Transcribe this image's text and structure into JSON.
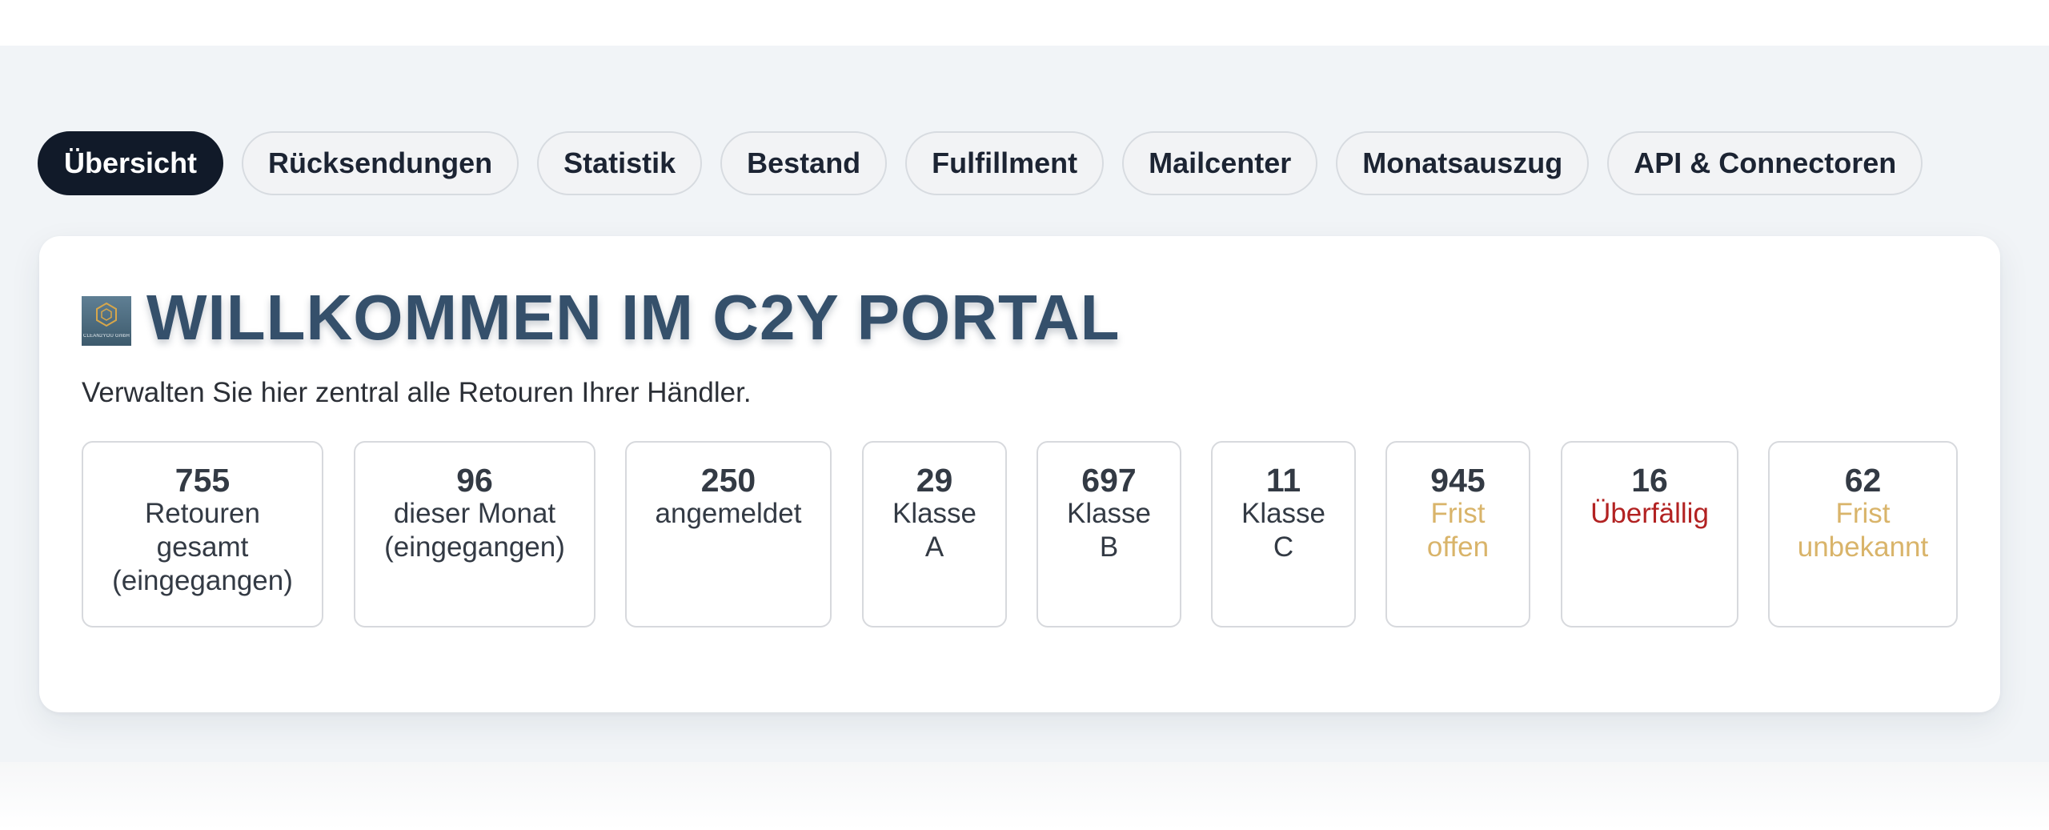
{
  "nav": {
    "tabs": [
      {
        "label": "Übersicht",
        "active": true
      },
      {
        "label": "Rücksendungen",
        "active": false
      },
      {
        "label": "Statistik",
        "active": false
      },
      {
        "label": "Bestand",
        "active": false
      },
      {
        "label": "Fulfillment",
        "active": false
      },
      {
        "label": "Mailcenter",
        "active": false
      },
      {
        "label": "Monatsauszug",
        "active": false
      },
      {
        "label": "API & Connectoren",
        "active": false
      }
    ]
  },
  "header": {
    "logo_text": "CLEAN2YOU GmbH",
    "logo_icon": "hexagon-logo-icon",
    "title": "WILLKOMMEN IM C2Y PORTAL",
    "subtitle": "Verwalten Sie hier zentral alle Retouren Ihrer Händler."
  },
  "stats": [
    {
      "value": "755",
      "label": "Retouren gesamt (eingegangen)",
      "tone": "normal"
    },
    {
      "value": "96",
      "label": "dieser Monat (eingegangen)",
      "tone": "normal"
    },
    {
      "value": "250",
      "label": "angemeldet",
      "tone": "normal"
    },
    {
      "value": "29",
      "label": "Klasse A",
      "tone": "normal"
    },
    {
      "value": "697",
      "label": "Klasse B",
      "tone": "normal"
    },
    {
      "value": "11",
      "label": "Klasse C",
      "tone": "normal"
    },
    {
      "value": "945",
      "label": "Frist offen",
      "tone": "warn"
    },
    {
      "value": "16",
      "label": "Überfällig",
      "tone": "danger"
    },
    {
      "value": "62",
      "label": "Frist unbekannt",
      "tone": "warn"
    }
  ],
  "colors": {
    "active_tab": "#111a29",
    "title": "#35506b",
    "warn": "#d9b46a",
    "danger": "#b22222"
  }
}
